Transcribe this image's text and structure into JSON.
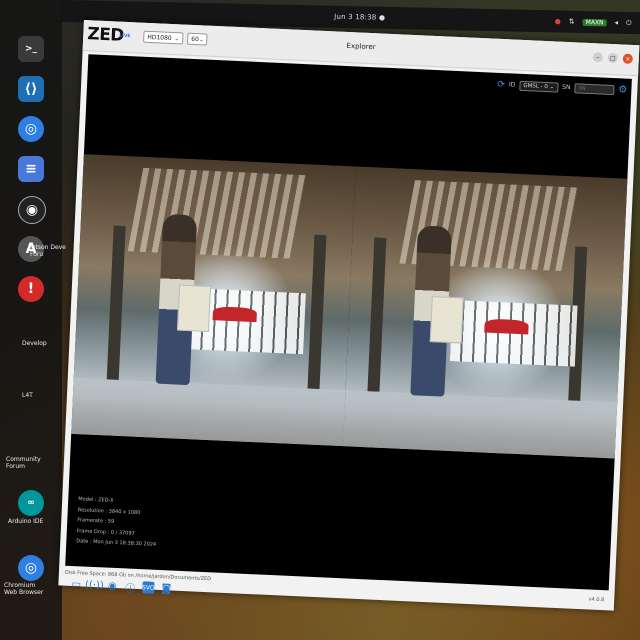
{
  "topbar": {
    "clock": "Jun 3  18:38  ●",
    "maxn": "MAXN"
  },
  "dock": {
    "icons": [
      {
        "name": "terminal",
        "glyph": ">_",
        "color": "#3a3a3a"
      },
      {
        "name": "vscode",
        "glyph": "⟨⟩",
        "color": "#1f6fb5"
      },
      {
        "name": "chromium",
        "glyph": "◎",
        "color": "#2f7fe0"
      },
      {
        "name": "text-editor",
        "glyph": "≡",
        "color": "#4a78d8"
      },
      {
        "name": "obs",
        "glyph": "◉",
        "color": "#222"
      },
      {
        "name": "app-center",
        "glyph": "A",
        "color": "#555"
      },
      {
        "name": "error",
        "glyph": "!",
        "color": "#d42a2a"
      }
    ]
  },
  "desktop_labels": [
    "Jetson Deve Foru",
    "Develop",
    "L4T",
    "Community Forum",
    "Arduino IDE",
    "Chromium Web Browser"
  ],
  "window": {
    "brand": "ZED",
    "live": "LIVE",
    "resolution": "HD1080",
    "fps": "60",
    "title": "Explorer",
    "id_label": "ID",
    "camera_select": "GMSL - 0",
    "sn_label": "SN",
    "sn_placeholder": "SN",
    "info": {
      "model": "Model : ZED-X",
      "resolution": "Resolution : 3840 x 1080",
      "framerate": "Framerate : 59",
      "frame_drop": "Frame Drop : 0 / 37097",
      "date": "Date : Mon Jun 3 18:38:30 2024"
    },
    "disk_space": "Disk Free Space: 868 Gb  on /home/jardon/Documents/ZED",
    "version": "v4.0.8"
  }
}
